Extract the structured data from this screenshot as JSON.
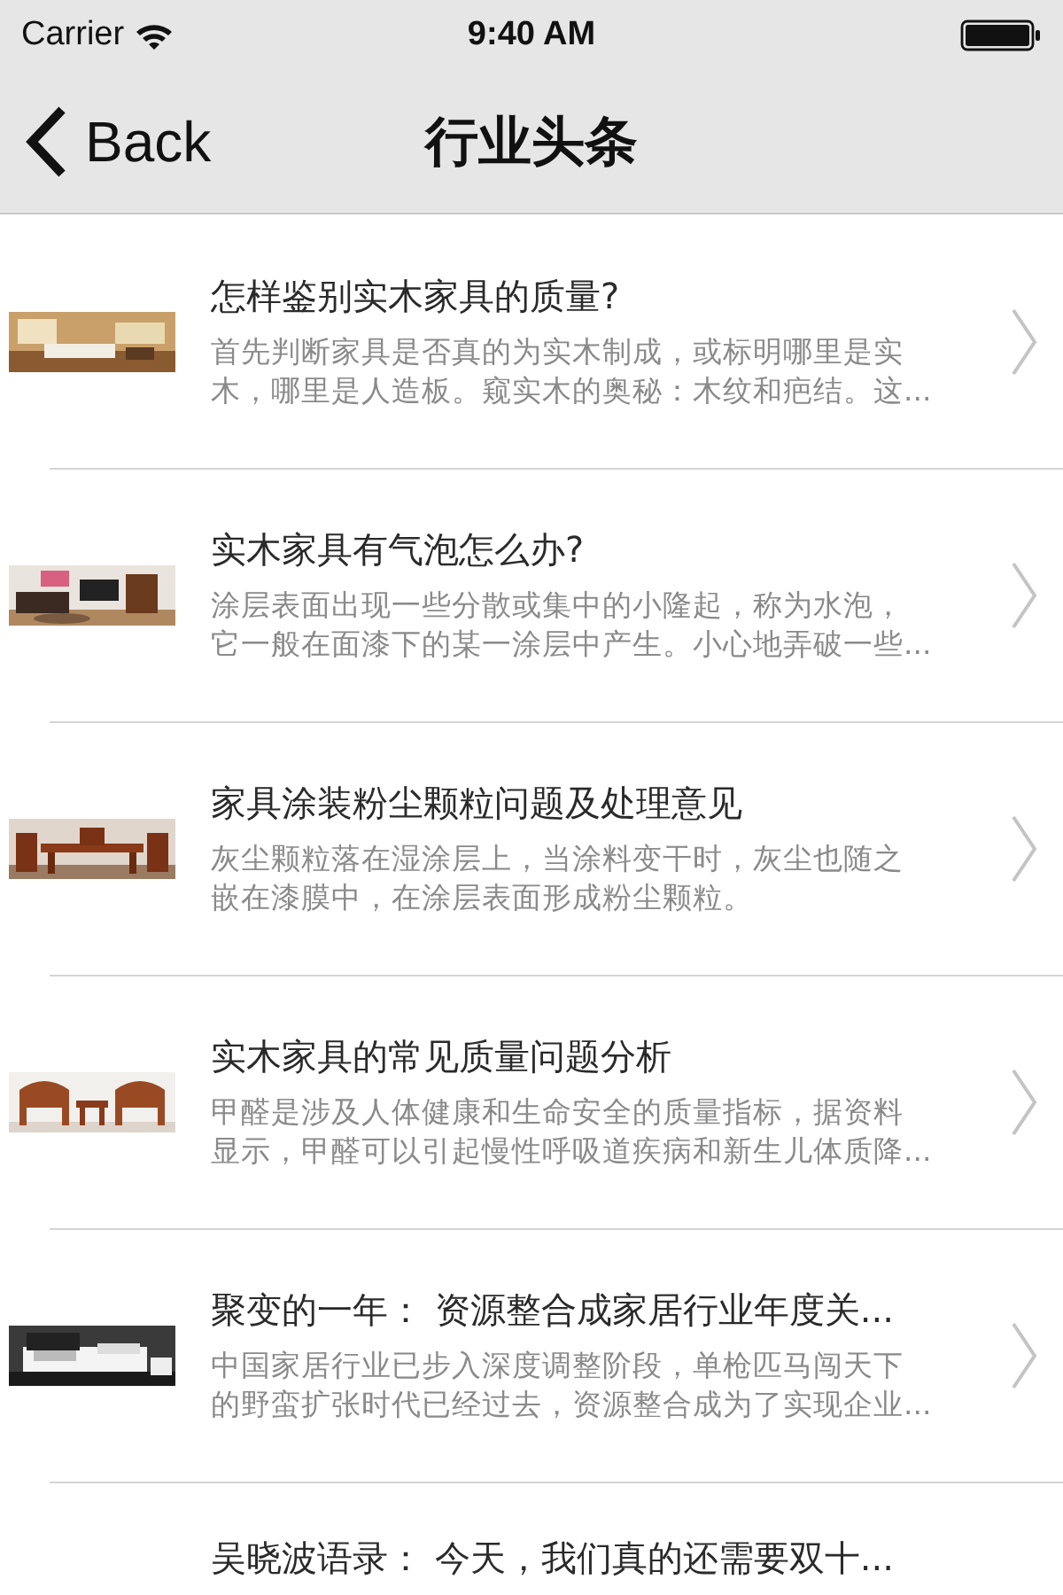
{
  "status_bar": {
    "carrier": "Carrier",
    "time": "9:40 AM"
  },
  "nav_bar": {
    "back": "Back",
    "title": "行业头条"
  },
  "articles": [
    {
      "kind": "full",
      "title": "怎样鉴别实木家具的质量?",
      "description_lines": [
        "首先判断家具是否真的为实木制成，或标明哪里是实",
        "木，哪里是人造板。窥实木的奥秘：木纹和疤结。这..."
      ]
    },
    {
      "kind": "full",
      "title": "实木家具有气泡怎么办?",
      "description_lines": [
        "涂层表面出现一些分散或集中的小隆起，称为水泡，",
        "它一般在面漆下的某一涂层中产生。小心地弄破一些..."
      ]
    },
    {
      "kind": "full",
      "title": "家具涂装粉尘颗粒问题及处理意见",
      "description_lines": [
        "灰尘颗粒落在湿涂层上，当涂料变干时，灰尘也随之",
        "嵌在漆膜中，在涂层表面形成粉尘颗粒。"
      ]
    },
    {
      "kind": "full",
      "title": "实木家具的常见质量问题分析",
      "description_lines": [
        "甲醛是涉及人体健康和生命安全的质量指标，据资料",
        "显示，甲醛可以引起慢性呼吸道疾病和新生儿体质降..."
      ]
    },
    {
      "kind": "full",
      "title": "聚变的一年： 资源整合成家居行业年度关...",
      "description_lines": [
        "中国家居行业已步入深度调整阶段，单枪匹马闯天下",
        "的野蛮扩张时代已经过去，资源整合成为了实现企业..."
      ]
    },
    {
      "kind": "partial",
      "title": "吴晓波语录： 今天，我们真的还需要双十..."
    }
  ]
}
